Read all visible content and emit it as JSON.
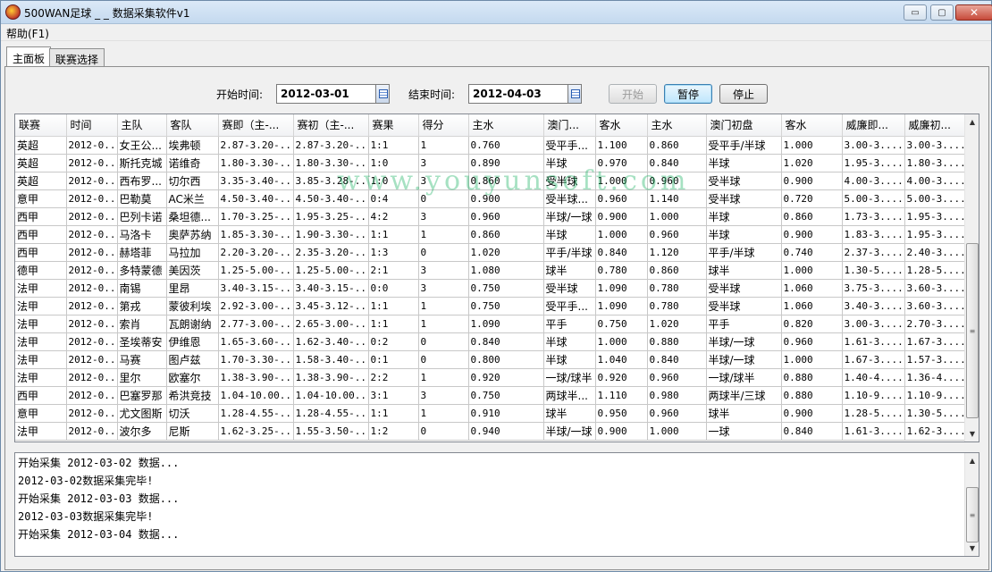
{
  "window": {
    "title": "500WAN足球 _ _ 数据采集软件v1",
    "minimize_label": "▭",
    "maximize_label": "▢",
    "close_label": "✕"
  },
  "menu": {
    "help_label": "帮助(F1)"
  },
  "tabs": [
    {
      "label": "主面板",
      "active": true
    },
    {
      "label": "联赛选择",
      "active": false
    }
  ],
  "controls": {
    "start_label": "开始时间:",
    "start_value": "2012-03-01",
    "end_label": "结束时间:",
    "end_value": "2012-04-03",
    "btn_start": "开始",
    "btn_pause": "暂停",
    "btn_stop": "停止"
  },
  "grid": {
    "columns": [
      "联赛",
      "时间",
      "主队",
      "客队",
      "赛即（主-...",
      "赛初（主-...",
      "赛果",
      "得分",
      "主水",
      "澳门...",
      "客水",
      "主水",
      "澳门初盘",
      "客水",
      "威廉即...",
      "威廉初..."
    ],
    "rows": [
      [
        "英超",
        "2012-0...",
        "女王公...",
        "埃弗顿",
        "2.87-3.20-...",
        "2.87-3.20-...",
        "1:1",
        "1",
        "0.760",
        "受平手...",
        "1.100",
        "0.860",
        "受平手/半球",
        "1.000",
        "3.00-3....",
        "3.00-3...."
      ],
      [
        "英超",
        "2012-0...",
        "斯托克城",
        "诺维奇",
        "1.80-3.30-...",
        "1.80-3.30-...",
        "1:0",
        "3",
        "0.890",
        "半球",
        "0.970",
        "0.840",
        "半球",
        "1.020",
        "1.95-3....",
        "1.80-3...."
      ],
      [
        "英超",
        "2012-0...",
        "西布罗...",
        "切尔西",
        "3.35-3.40-...",
        "3.85-3.28-...",
        "1:0",
        "3",
        "0.860",
        "受半球",
        "1.000",
        "0.960",
        "受半球",
        "0.900",
        "4.00-3....",
        "4.00-3...."
      ],
      [
        "意甲",
        "2012-0...",
        "巴勒莫",
        "AC米兰",
        "4.50-3.40-...",
        "4.50-3.40-...",
        "0:4",
        "0",
        "0.900",
        "受半球...",
        "0.960",
        "1.140",
        "受半球",
        "0.720",
        "5.00-3....",
        "5.00-3...."
      ],
      [
        "西甲",
        "2012-0...",
        "巴列卡诺",
        "桑坦德...",
        "1.70-3.25-...",
        "1.95-3.25-...",
        "4:2",
        "3",
        "0.960",
        "半球/一球",
        "0.900",
        "1.000",
        "半球",
        "0.860",
        "1.73-3....",
        "1.95-3...."
      ],
      [
        "西甲",
        "2012-0...",
        "马洛卡",
        "奥萨苏纳",
        "1.85-3.30-...",
        "1.90-3.30-...",
        "1:1",
        "1",
        "0.860",
        "半球",
        "1.000",
        "0.960",
        "半球",
        "0.900",
        "1.83-3....",
        "1.95-3...."
      ],
      [
        "西甲",
        "2012-0...",
        "赫塔菲",
        "马拉加",
        "2.20-3.20-...",
        "2.35-3.20-...",
        "1:3",
        "0",
        "1.020",
        "平手/半球",
        "0.840",
        "1.120",
        "平手/半球",
        "0.740",
        "2.37-3....",
        "2.40-3...."
      ],
      [
        "德甲",
        "2012-0...",
        "多特蒙德",
        "美因茨",
        "1.25-5.00-...",
        "1.25-5.00-...",
        "2:1",
        "3",
        "1.080",
        "球半",
        "0.780",
        "0.860",
        "球半",
        "1.000",
        "1.30-5....",
        "1.28-5...."
      ],
      [
        "法甲",
        "2012-0...",
        "南锡",
        "里昂",
        "3.40-3.15-...",
        "3.40-3.15-...",
        "0:0",
        "3",
        "0.750",
        "受半球",
        "1.090",
        "0.780",
        "受半球",
        "1.060",
        "3.75-3....",
        "3.60-3...."
      ],
      [
        "法甲",
        "2012-0...",
        "第戎",
        "蒙彼利埃",
        "2.92-3.00-...",
        "3.45-3.12-...",
        "1:1",
        "1",
        "0.750",
        "受平手...",
        "1.090",
        "0.780",
        "受半球",
        "1.060",
        "3.40-3....",
        "3.60-3...."
      ],
      [
        "法甲",
        "2012-0...",
        "索肖",
        "瓦朗谢纳",
        "2.77-3.00-...",
        "2.65-3.00-...",
        "1:1",
        "1",
        "1.090",
        "平手",
        "0.750",
        "1.020",
        "平手",
        "0.820",
        "3.00-3....",
        "2.70-3...."
      ],
      [
        "法甲",
        "2012-0...",
        "圣埃蒂安",
        "伊维恩",
        "1.65-3.60-...",
        "1.62-3.40-...",
        "0:2",
        "0",
        "0.840",
        "半球",
        "1.000",
        "0.880",
        "半球/一球",
        "0.960",
        "1.61-3....",
        "1.67-3...."
      ],
      [
        "法甲",
        "2012-0...",
        "马赛",
        "图卢兹",
        "1.70-3.30-...",
        "1.58-3.40-...",
        "0:1",
        "0",
        "0.800",
        "半球",
        "1.040",
        "0.840",
        "半球/一球",
        "1.000",
        "1.67-3....",
        "1.57-3...."
      ],
      [
        "法甲",
        "2012-0...",
        "里尔",
        "欧塞尔",
        "1.38-3.90-...",
        "1.38-3.90-...",
        "2:2",
        "1",
        "0.920",
        "一球/球半",
        "0.920",
        "0.960",
        "一球/球半",
        "0.880",
        "1.40-4....",
        "1.36-4...."
      ],
      [
        "西甲",
        "2012-0...",
        "巴塞罗那",
        "希洪竞技",
        "1.04-10.00...",
        "1.04-10.00...",
        "3:1",
        "3",
        "0.750",
        "两球半...",
        "1.110",
        "0.980",
        "两球半/三球",
        "0.880",
        "1.10-9....",
        "1.10-9...."
      ],
      [
        "意甲",
        "2012-0...",
        "尤文图斯",
        "切沃",
        "1.28-4.55-...",
        "1.28-4.55-...",
        "1:1",
        "1",
        "0.910",
        "球半",
        "0.950",
        "0.960",
        "球半",
        "0.900",
        "1.28-5....",
        "1.30-5...."
      ],
      [
        "法甲",
        "2012-0...",
        "波尔多",
        "尼斯",
        "1.62-3.25-...",
        "1.55-3.50-...",
        "1:2",
        "0",
        "0.940",
        "半球/一球",
        "0.900",
        "1.000",
        "一球",
        "0.840",
        "1.61-3....",
        "1.62-3...."
      ]
    ]
  },
  "watermark": "www.youyunsoft.com",
  "log": [
    "开始采集 2012-03-02 数据...",
    "2012-03-02数据采集完毕!",
    "开始采集 2012-03-03 数据...",
    "2012-03-03数据采集完毕!",
    "开始采集 2012-03-04 数据..."
  ]
}
